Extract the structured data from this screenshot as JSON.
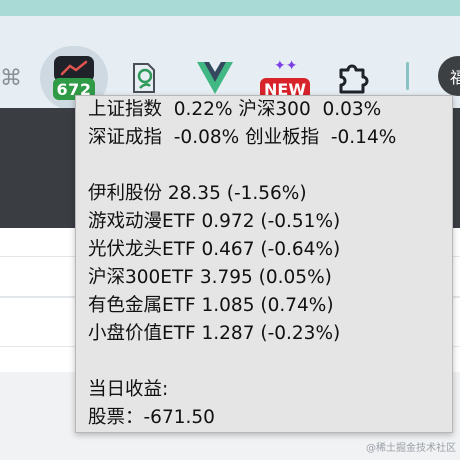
{
  "toolbar": {
    "extensions": [
      {
        "id": "hash",
        "icon": "hash-icon",
        "glyph": "⌘"
      },
      {
        "id": "stock",
        "icon": "stock-monitor-icon",
        "badge": "672",
        "badge_color": "#2f9b47"
      },
      {
        "id": "doc",
        "icon": "document-edit-icon"
      },
      {
        "id": "vue",
        "icon": "vue-devtools-icon"
      },
      {
        "id": "new",
        "icon": "new-badge-icon",
        "badge": "NEW",
        "badge_color": "#d8232a"
      },
      {
        "id": "puzzle",
        "icon": "puzzle-icon"
      }
    ],
    "profile_initial": "福"
  },
  "tooltip": {
    "lines": [
      "上证指数  0.22% 沪深300  0.03%",
      "深证成指  -0.08% 创业板指  -0.14%",
      "",
      "伊利股份 28.35 (-1.56%)",
      "游戏动漫ETF 0.972 (-0.51%)",
      "光伏龙头ETF 0.467 (-0.64%)",
      "沪深300ETF 3.795 (0.05%)",
      "有色金属ETF 1.085 (0.74%)",
      "小盘价值ETF 1.287 (-0.23%)",
      "",
      "当日收益:",
      "股票：-671.50"
    ]
  },
  "watermark": "@稀土掘金技术社区"
}
